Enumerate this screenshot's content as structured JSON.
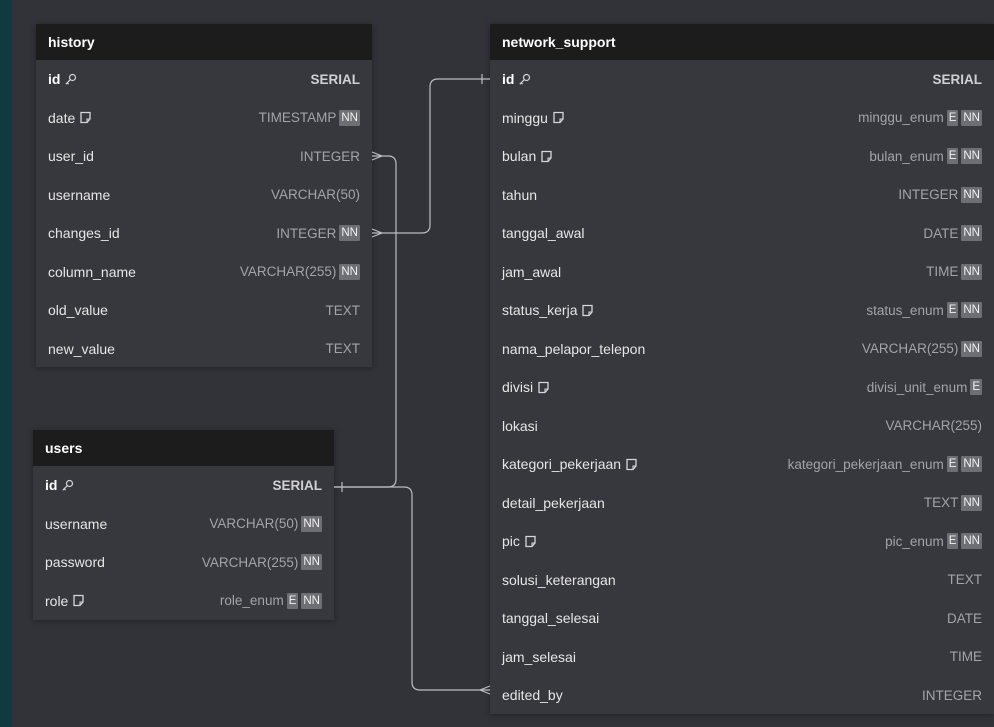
{
  "tables": {
    "history": {
      "title": "history",
      "rows": [
        {
          "name": "id",
          "type": "SERIAL",
          "badges": [],
          "icon": "key-icon",
          "pk": true
        },
        {
          "name": "date",
          "type": "TIMESTAMP",
          "badges": [
            "NN"
          ],
          "icon": "note-icon"
        },
        {
          "name": "user_id",
          "type": "INTEGER",
          "badges": []
        },
        {
          "name": "username",
          "type": "VARCHAR(50)",
          "badges": []
        },
        {
          "name": "changes_id",
          "type": "INTEGER",
          "badges": [
            "NN"
          ]
        },
        {
          "name": "column_name",
          "type": "VARCHAR(255)",
          "badges": [
            "NN"
          ]
        },
        {
          "name": "old_value",
          "type": "TEXT",
          "badges": []
        },
        {
          "name": "new_value",
          "type": "TEXT",
          "badges": []
        }
      ]
    },
    "users": {
      "title": "users",
      "rows": [
        {
          "name": "id",
          "type": "SERIAL",
          "badges": [],
          "icon": "key-icon",
          "pk": true
        },
        {
          "name": "username",
          "type": "VARCHAR(50)",
          "badges": [
            "NN"
          ]
        },
        {
          "name": "password",
          "type": "VARCHAR(255)",
          "badges": [
            "NN"
          ]
        },
        {
          "name": "role",
          "type": "role_enum",
          "badges": [
            "E",
            "NN"
          ],
          "icon": "note-icon"
        }
      ]
    },
    "network_support": {
      "title": "network_support",
      "rows": [
        {
          "name": "id",
          "type": "SERIAL",
          "badges": [],
          "icon": "key-icon",
          "pk": true
        },
        {
          "name": "minggu",
          "type": "minggu_enum",
          "badges": [
            "E",
            "NN"
          ],
          "icon": "note-icon"
        },
        {
          "name": "bulan",
          "type": "bulan_enum",
          "badges": [
            "E",
            "NN"
          ],
          "icon": "note-icon"
        },
        {
          "name": "tahun",
          "type": "INTEGER",
          "badges": [
            "NN"
          ]
        },
        {
          "name": "tanggal_awal",
          "type": "DATE",
          "badges": [
            "NN"
          ]
        },
        {
          "name": "jam_awal",
          "type": "TIME",
          "badges": [
            "NN"
          ]
        },
        {
          "name": "status_kerja",
          "type": "status_enum",
          "badges": [
            "E",
            "NN"
          ],
          "icon": "note-icon"
        },
        {
          "name": "nama_pelapor_telepon",
          "type": "VARCHAR(255)",
          "badges": [
            "NN"
          ]
        },
        {
          "name": "divisi",
          "type": "divisi_unit_enum",
          "badges": [
            "E"
          ],
          "icon": "note-icon"
        },
        {
          "name": "lokasi",
          "type": "VARCHAR(255)",
          "badges": []
        },
        {
          "name": "kategori_pekerjaan",
          "type": "kategori_pekerjaan_enum",
          "badges": [
            "E",
            "NN"
          ],
          "icon": "note-icon"
        },
        {
          "name": "detail_pekerjaan",
          "type": "TEXT",
          "badges": [
            "NN"
          ]
        },
        {
          "name": "pic",
          "type": "pic_enum",
          "badges": [
            "E",
            "NN"
          ],
          "icon": "note-icon"
        },
        {
          "name": "solusi_keterangan",
          "type": "TEXT",
          "badges": []
        },
        {
          "name": "tanggal_selesai",
          "type": "DATE",
          "badges": []
        },
        {
          "name": "jam_selesai",
          "type": "TIME",
          "badges": []
        },
        {
          "name": "edited_by",
          "type": "INTEGER",
          "badges": []
        }
      ]
    }
  },
  "colors": {
    "background": "#323239",
    "border": "#0f3a3f",
    "table_body": "#37373e",
    "table_header": "#1c1c1c",
    "badge": "#6e6e75",
    "edge": "#bcbcc2"
  }
}
